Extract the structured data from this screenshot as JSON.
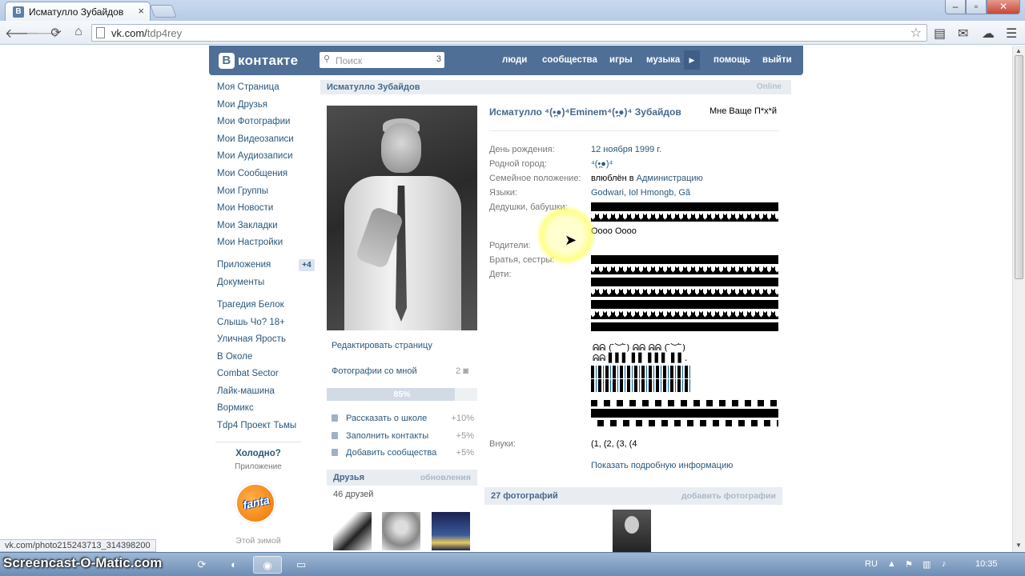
{
  "browser": {
    "tab_title": "Исматулло Зубайдов",
    "tab_close": "×",
    "url_host": "vk.com/",
    "url_path": "tdp4rey",
    "win_min": "–",
    "win_max": "▫",
    "win_close": "✕"
  },
  "vk": {
    "logo_text": "контакте",
    "logo_letter": "В",
    "search_placeholder": "Поиск",
    "search_count": "3",
    "nav": [
      "люди",
      "сообщества",
      "игры",
      "музыка",
      "помощь",
      "выйти"
    ],
    "more_arrow": "▶"
  },
  "left_menu": {
    "main": [
      "Моя Страница",
      "Мои Друзья",
      "Мои Фотографии",
      "Мои Видеозаписи",
      "Мои Аудиозаписи",
      "Мои Сообщения",
      "Мои Группы",
      "Мои Новости",
      "Мои Закладки",
      "Мои Настройки"
    ],
    "apps": [
      "Приложения",
      "Документы"
    ],
    "apps_badge": "+4",
    "groups": [
      "Трагедия Белок",
      "Слышь Чо? 18+",
      "Уличная Ярость",
      "В Околе",
      "Combat Sector",
      "Лайк-машина",
      "Вормикс",
      "Tdp4 Проект Тьмы"
    ],
    "ad_title": "Холодно?",
    "ad_subtitle": "Приложение",
    "ad_logo": "fanta",
    "ad_more": "Этой зимой"
  },
  "profile": {
    "bar_name": "Исматулло Зубайдов",
    "bar_online": "Online",
    "full_name": "Исматулло ⁴(•̪●)⁴Eminem⁴(•̪●)⁴ Зубайдов",
    "status": "Мне Ваще П*х*й",
    "info": [
      {
        "label": "День рождения:",
        "value": "12 ноября 1999 г."
      },
      {
        "label": "Родной город:",
        "value": "⁴(•̪●)⁴"
      },
      {
        "label": "Семейное положение:",
        "value_prefix": "влюблён в ",
        "value": "Администрацию"
      },
      {
        "label": "Языки:",
        "value": "Godwari, Iol Hmongb, Gã"
      },
      {
        "label": "Дедушки, бабушки:",
        "value": "Oooo Oooo"
      },
      {
        "label": "Родители:",
        "value": ""
      },
      {
        "label": "Братья, сестры:",
        "value": ""
      },
      {
        "label": "Дети:",
        "value": ""
      },
      {
        "label": "Внуки:",
        "value": "(1, (2, (3, (4"
      }
    ],
    "kaomoji_1": "ᕱᕱ ( ̄︶ ̄) ᕱᕱ ᕱᕱ ( ̄︶ ̄)",
    "kaomoji_2": "ᕱᕱ ▌▌▌ ▌▌ ▌▌▌ ▌▌.",
    "more_info": "Показать подробную информацию",
    "actions": {
      "edit": "Редактировать страницу",
      "photos_with_me": "Фотографии со мной",
      "photos_with_me_count": "2"
    },
    "progress": {
      "label": "85%",
      "value": 85
    },
    "suggestions": [
      {
        "text": "Рассказать о школе",
        "pct": "+10%"
      },
      {
        "text": "Заполнить контакты",
        "pct": "+5%"
      },
      {
        "text": "Добавить сообщества",
        "pct": "+5%"
      }
    ],
    "friends": {
      "title": "Друзья",
      "updates": "обновления",
      "count": "46 друзей"
    },
    "photos": {
      "title": "27 фотографий",
      "add": "добавить фотографии"
    }
  },
  "status_url": "vk.com/photo215243713_314398200",
  "taskbar": {
    "watermark": "Screencast-O-Matic.com",
    "lang": "RU",
    "time": "10:35"
  }
}
